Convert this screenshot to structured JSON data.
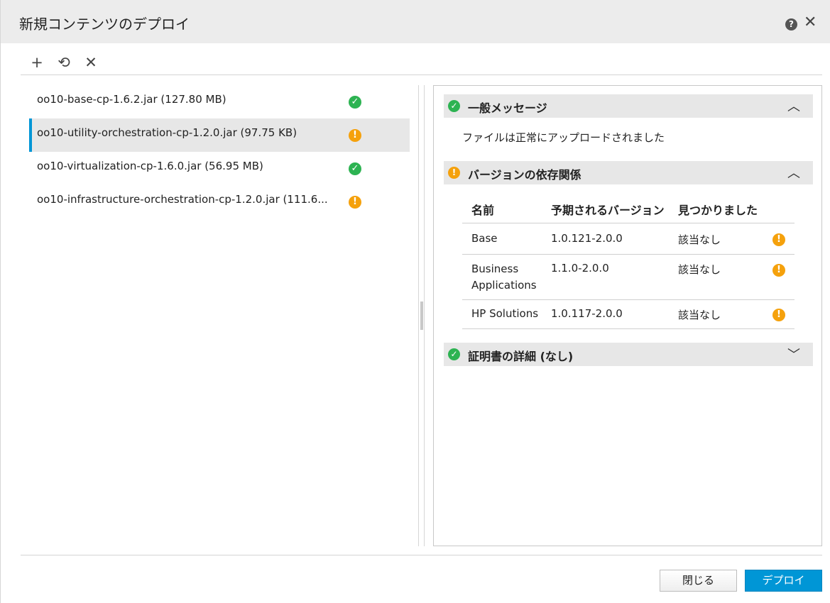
{
  "dialog": {
    "title": "新規コンテンツのデプロイ",
    "help_icon": "?",
    "close_icon": "✕"
  },
  "toolbar": {
    "add_icon": "+",
    "refresh_icon": "⟲",
    "remove_icon": "✕"
  },
  "files": [
    {
      "name": "oo10-base-cp-1.6.2.jar (127.80 MB)",
      "status": "ok",
      "status_glyph": "✓"
    },
    {
      "name": "oo10-utility-orchestration-cp-1.2.0.jar (97.75 KB)",
      "status": "warning",
      "status_glyph": "!"
    },
    {
      "name": "oo10-virtualization-cp-1.6.0.jar (56.95 MB)",
      "status": "ok",
      "status_glyph": "✓"
    },
    {
      "name": "oo10-infrastructure-orchestration-cp-1.2.0.jar (111.6...",
      "status": "warning",
      "status_glyph": "!"
    }
  ],
  "details": {
    "general": {
      "title": "一般メッセージ",
      "status_glyph": "✓",
      "chevron": "︿",
      "message": "ファイルは正常にアップロードされました"
    },
    "dependencies": {
      "title": "バージョンの依存関係",
      "status_glyph": "!",
      "chevron": "︿",
      "columns": [
        "名前",
        "予期されるバージョン",
        "見つかりました"
      ],
      "rows": [
        {
          "name": "Base",
          "expected": "1.0.121-2.0.0",
          "found": "該当なし",
          "icon": "!"
        },
        {
          "name": "Business Applications",
          "expected": "1.1.0-2.0.0",
          "found": "該当なし",
          "icon": "!"
        },
        {
          "name": "HP Solutions",
          "expected": "1.0.117-2.0.0",
          "found": "該当なし",
          "icon": "!"
        }
      ]
    },
    "certificate": {
      "title": "証明書の詳細 (なし)",
      "status_glyph": "✓",
      "chevron": "﹀"
    }
  },
  "footer": {
    "close_label": "閉じる",
    "deploy_label": "デプロイ"
  },
  "colors": {
    "accent": "#0096d6",
    "ok": "#2db352",
    "warning": "#f5a10c",
    "header_bg": "#ececec"
  }
}
